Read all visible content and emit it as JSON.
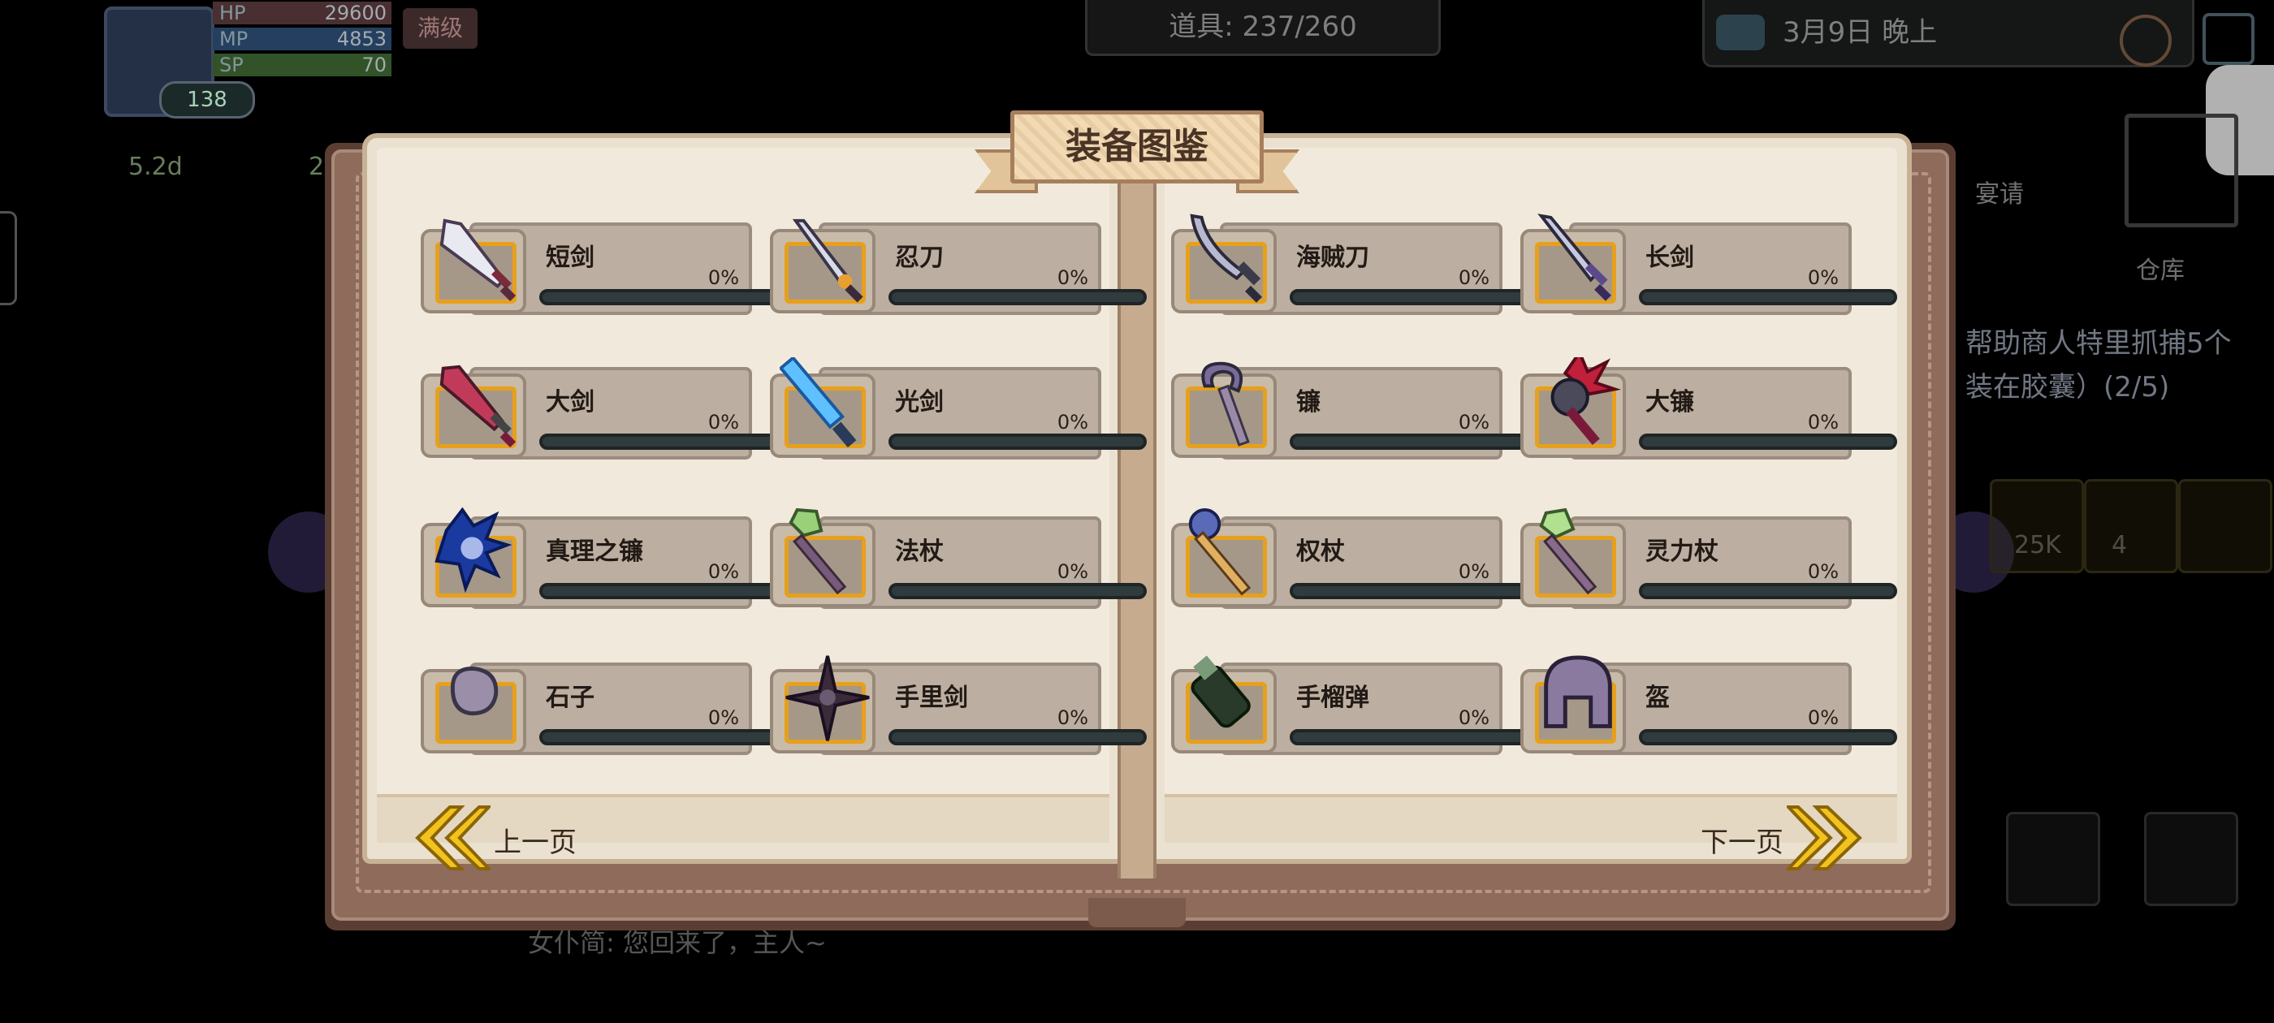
{
  "hud": {
    "level": "138",
    "hp_label": "HP",
    "hp_value": "29600",
    "mp_label": "MP",
    "mp_value": "4853",
    "sp_label": "SP",
    "sp_value": "70",
    "tag": "满级",
    "left_stat": "5.2d",
    "left_stat2": "2",
    "items_label": "道具: 237/260",
    "date": "3月9日 晚上",
    "warehouse": "仓库",
    "banquet": "宴请",
    "quest_lines": [
      "帮助商人特里抓捕5个",
      "装在胶囊）(2/5)"
    ],
    "side_counts": [
      "25K",
      "4"
    ],
    "bottom_text": "女仆简: 您回来了，主人~"
  },
  "book": {
    "title": "装备图鉴",
    "prev_label": "上一页",
    "next_label": "下一页",
    "left_page": [
      {
        "name": "短剑",
        "pct": "0%",
        "progress": 0,
        "icon": "dagger-icon"
      },
      {
        "name": "忍刀",
        "pct": "0%",
        "progress": 0,
        "icon": "ninja-blade-icon"
      },
      {
        "name": "大剑",
        "pct": "0%",
        "progress": 0,
        "icon": "greatsword-icon"
      },
      {
        "name": "光剑",
        "pct": "0%",
        "progress": 0,
        "icon": "lightsaber-icon"
      },
      {
        "name": "真理之镰",
        "pct": "0%",
        "progress": 0,
        "icon": "truth-scythe-icon"
      },
      {
        "name": "法杖",
        "pct": "0%",
        "progress": 0,
        "icon": "staff-icon"
      },
      {
        "name": "石子",
        "pct": "0%",
        "progress": 0,
        "icon": "pebble-icon"
      },
      {
        "name": "手里剑",
        "pct": "0%",
        "progress": 0,
        "icon": "shuriken-icon"
      }
    ],
    "right_page": [
      {
        "name": "海贼刀",
        "pct": "0%",
        "progress": 0,
        "icon": "pirate-sabre-icon"
      },
      {
        "name": "长剑",
        "pct": "0%",
        "progress": 0,
        "icon": "longsword-icon"
      },
      {
        "name": "镰",
        "pct": "0%",
        "progress": 0,
        "icon": "sickle-icon"
      },
      {
        "name": "大镰",
        "pct": "0%",
        "progress": 0,
        "icon": "great-scythe-icon"
      },
      {
        "name": "权杖",
        "pct": "0%",
        "progress": 0,
        "icon": "scepter-icon"
      },
      {
        "name": "灵力杖",
        "pct": "0%",
        "progress": 0,
        "icon": "spirit-staff-icon"
      },
      {
        "name": "手榴弹",
        "pct": "0%",
        "progress": 0,
        "icon": "grenade-icon"
      },
      {
        "name": "盔",
        "pct": "0%",
        "progress": 0,
        "icon": "helmet-icon"
      }
    ]
  },
  "colors": {
    "accent_orange": "#e7a01c",
    "progress_bar": "#2f3b3c",
    "page": "#f1eadc",
    "cover": "#8f6b5b",
    "nav_arrow": "#f2c21d"
  }
}
